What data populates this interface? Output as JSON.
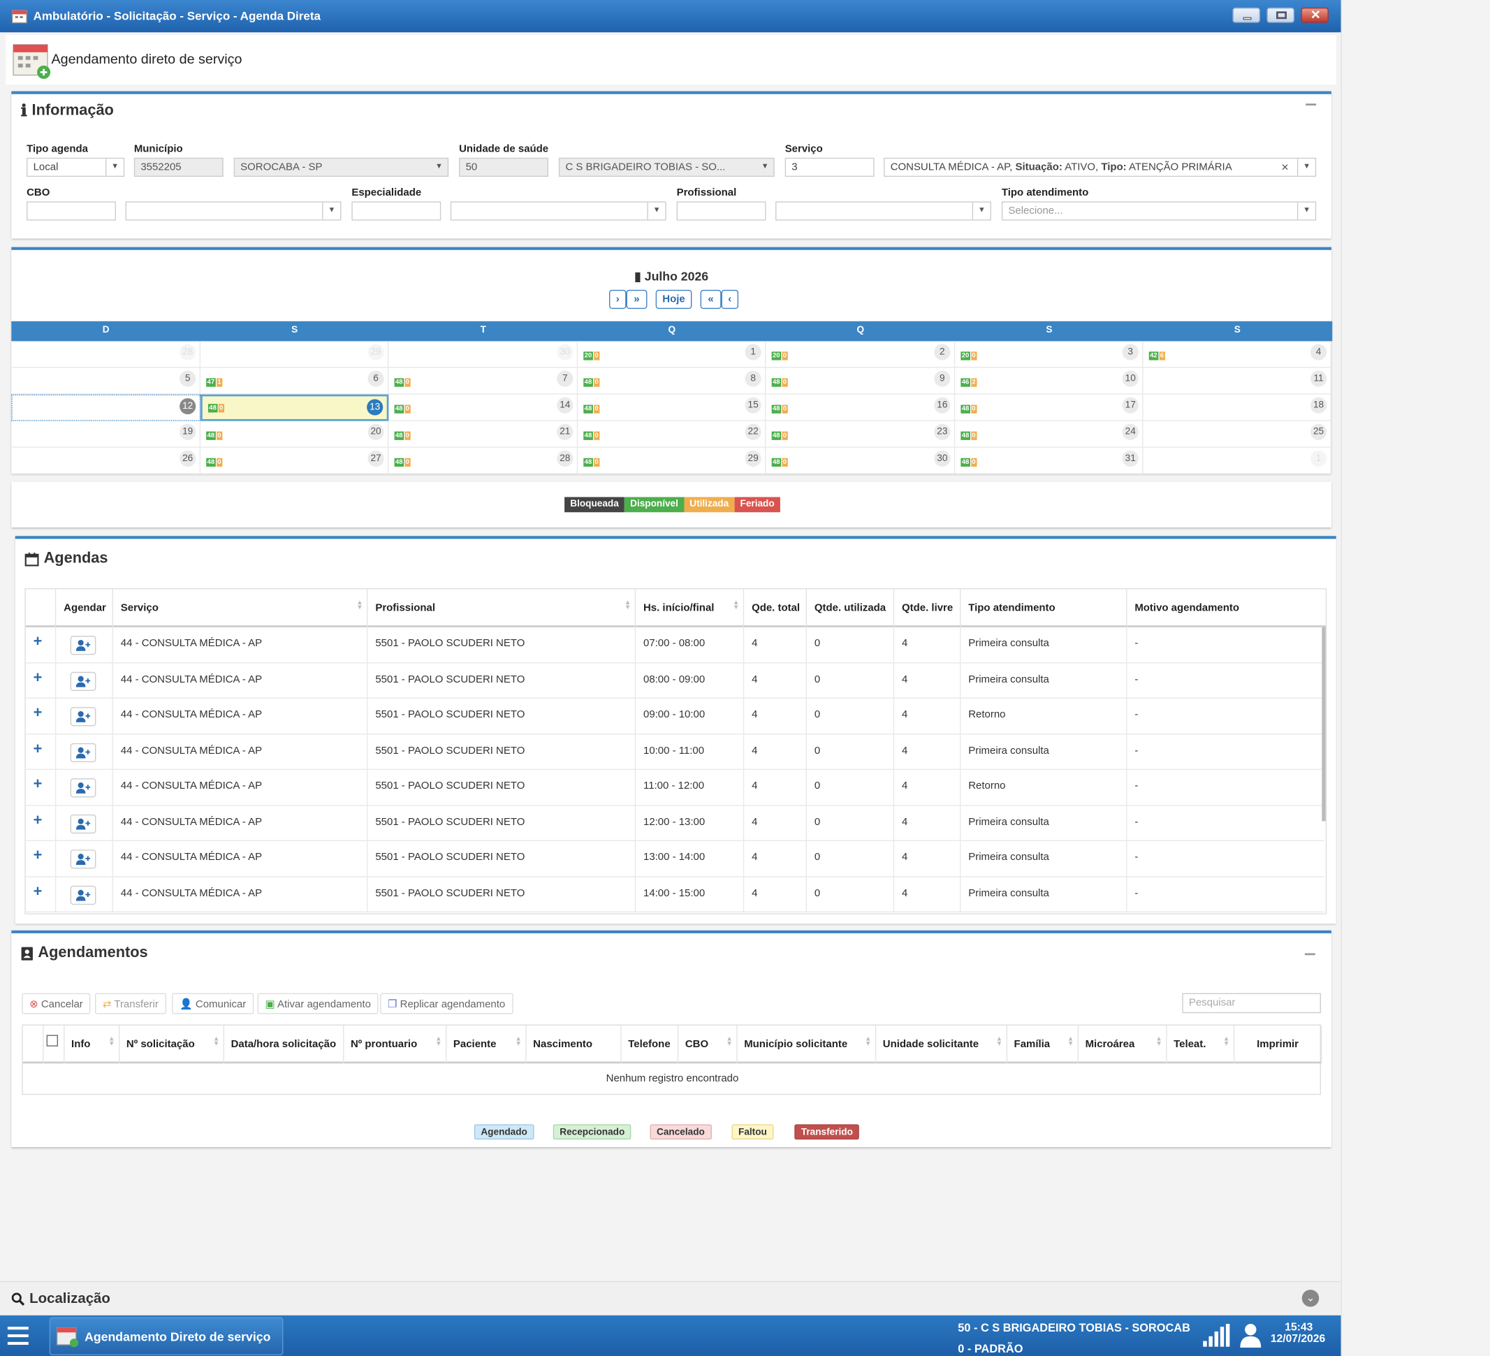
{
  "window": {
    "title": "Ambulatório - Solicitação - Serviço - Agenda Direta"
  },
  "header": {
    "title": "Agendamento direto de serviço"
  },
  "info": {
    "title": "Informação",
    "tipo_agenda_label": "Tipo agenda",
    "tipo_agenda_value": "Local",
    "municipio_label": "Município",
    "municipio_code": "3552205",
    "municipio_name": "SOROCABA - SP",
    "unidade_label": "Unidade de saúde",
    "unidade_code": "50",
    "unidade_name": "C S BRIGADEIRO TOBIAS - SO...",
    "servico_label": "Serviço",
    "servico_code": "3",
    "servico_desc_a": "CONSULTA MÉDICA - AP,",
    "servico_sit_label": "Situação:",
    "servico_sit_value": "ATIVO,",
    "servico_tipo_label": "Tipo:",
    "servico_tipo_value": "ATENÇÃO PRIMÁRIA",
    "cbo_label": "CBO",
    "especialidade_label": "Especialidade",
    "profissional_label": "Profissional",
    "tipo_atend_label": "Tipo atendimento",
    "tipo_atend_placeholder": "Selecione..."
  },
  "calendar": {
    "month_title": "Julho 2026",
    "hoje": "Hoje",
    "nav_next": "›",
    "nav_next2": "»",
    "nav_prev2": "«",
    "nav_prev": "‹",
    "days": [
      "D",
      "S",
      "T",
      "Q",
      "Q",
      "S",
      "S"
    ],
    "weeks": [
      [
        {
          "d": "28",
          "o": true
        },
        {
          "d": "29",
          "o": true
        },
        {
          "d": "30",
          "o": true
        },
        {
          "d": "1",
          "g": "20",
          "u": "0"
        },
        {
          "d": "2",
          "g": "20",
          "u": "0"
        },
        {
          "d": "3",
          "g": "20",
          "u": "0"
        },
        {
          "d": "4",
          "g": "42",
          "u": "6"
        }
      ],
      [
        {
          "d": "5"
        },
        {
          "d": "6",
          "g": "47",
          "u": "1"
        },
        {
          "d": "7",
          "g": "48",
          "u": "0"
        },
        {
          "d": "8",
          "g": "48",
          "u": "0"
        },
        {
          "d": "9",
          "g": "48",
          "u": "0"
        },
        {
          "d": "10",
          "g": "46",
          "u": "2"
        },
        {
          "d": "11"
        }
      ],
      [
        {
          "d": "12",
          "s": "sel"
        },
        {
          "d": "13",
          "s": "today",
          "g": "48",
          "u": "0"
        },
        {
          "d": "14",
          "g": "48",
          "u": "0"
        },
        {
          "d": "15",
          "g": "48",
          "u": "0"
        },
        {
          "d": "16",
          "g": "48",
          "u": "0"
        },
        {
          "d": "17",
          "g": "48",
          "u": "0"
        },
        {
          "d": "18"
        }
      ],
      [
        {
          "d": "19"
        },
        {
          "d": "20",
          "g": "48",
          "u": "0"
        },
        {
          "d": "21",
          "g": "48",
          "u": "0"
        },
        {
          "d": "22",
          "g": "48",
          "u": "0"
        },
        {
          "d": "23",
          "g": "48",
          "u": "0"
        },
        {
          "d": "24",
          "g": "48",
          "u": "0"
        },
        {
          "d": "25"
        }
      ],
      [
        {
          "d": "26"
        },
        {
          "d": "27",
          "g": "48",
          "u": "0"
        },
        {
          "d": "28",
          "g": "48",
          "u": "0"
        },
        {
          "d": "29",
          "g": "48",
          "u": "0"
        },
        {
          "d": "30",
          "g": "48",
          "u": "0"
        },
        {
          "d": "31",
          "g": "48",
          "u": "0"
        },
        {
          "d": "1",
          "o": true
        }
      ]
    ],
    "legend": [
      {
        "label": "Bloqueada",
        "color": "#444444"
      },
      {
        "label": "Disponível",
        "color": "#4cae4c"
      },
      {
        "label": "Utilizada",
        "color": "#f0ad4e"
      },
      {
        "label": "Feriado",
        "color": "#d9534f"
      }
    ]
  },
  "agendas": {
    "title": "Agendas",
    "columns": [
      "Agendar",
      "Serviço",
      "Profissional",
      "Hs. início/final",
      "Qde. total",
      "Qtde. utilizada",
      "Qtde. livre",
      "Tipo atendimento",
      "Motivo agendamento"
    ],
    "rows": [
      [
        "44 - CONSULTA MÉDICA - AP",
        "5501 - PAOLO SCUDERI NETO",
        "07:00 - 08:00",
        "4",
        "0",
        "4",
        "Primeira consulta",
        "-"
      ],
      [
        "44 - CONSULTA MÉDICA - AP",
        "5501 - PAOLO SCUDERI NETO",
        "08:00 - 09:00",
        "4",
        "0",
        "4",
        "Primeira consulta",
        "-"
      ],
      [
        "44 - CONSULTA MÉDICA - AP",
        "5501 - PAOLO SCUDERI NETO",
        "09:00 - 10:00",
        "4",
        "0",
        "4",
        "Retorno",
        "-"
      ],
      [
        "44 - CONSULTA MÉDICA - AP",
        "5501 - PAOLO SCUDERI NETO",
        "10:00 - 11:00",
        "4",
        "0",
        "4",
        "Primeira consulta",
        "-"
      ],
      [
        "44 - CONSULTA MÉDICA - AP",
        "5501 - PAOLO SCUDERI NETO",
        "11:00 - 12:00",
        "4",
        "0",
        "4",
        "Retorno",
        "-"
      ],
      [
        "44 - CONSULTA MÉDICA - AP",
        "5501 - PAOLO SCUDERI NETO",
        "12:00 - 13:00",
        "4",
        "0",
        "4",
        "Primeira consulta",
        "-"
      ],
      [
        "44 - CONSULTA MÉDICA - AP",
        "5501 - PAOLO SCUDERI NETO",
        "13:00 - 14:00",
        "4",
        "0",
        "4",
        "Primeira consulta",
        "-"
      ],
      [
        "44 - CONSULTA MÉDICA - AP",
        "5501 - PAOLO SCUDERI NETO",
        "14:00 - 15:00",
        "4",
        "0",
        "4",
        "Primeira consulta",
        "-"
      ]
    ]
  },
  "agendamentos": {
    "title": "Agendamentos",
    "cancelar": "Cancelar",
    "transferir": "Transferir",
    "comunicar": "Comunicar",
    "ativar": "Ativar agendamento",
    "replicar": "Replicar agendamento",
    "search_placeholder": "Pesquisar",
    "columns": [
      "Info",
      "Nº solicitação",
      "Data/hora solicitação",
      "Nº prontuario",
      "Paciente",
      "Nascimento",
      "Telefone",
      "CBO",
      "Município solicitante",
      "Unidade solicitante",
      "Família",
      "Microárea",
      "Teleat.",
      "Imprimir"
    ],
    "empty": "Nenhum registro encontrado",
    "legend": [
      {
        "label": "Agendado",
        "bg": "#cfe8f7",
        "fg": "#333333",
        "border": "#9cc8e6"
      },
      {
        "label": "Recepcionado",
        "bg": "#d6f0d6",
        "fg": "#333333",
        "border": "#a8d8a8"
      },
      {
        "label": "Cancelado",
        "bg": "#f8dada",
        "fg": "#333333",
        "border": "#e5b0b0"
      },
      {
        "label": "Faltou",
        "bg": "#fff6c8",
        "fg": "#333333",
        "border": "#e7d98c"
      },
      {
        "label": "Transferido",
        "bg": "#c0504d",
        "fg": "#ffffff",
        "border": "#a94442"
      }
    ]
  },
  "localizacao": {
    "title": "Localização"
  },
  "taskbar": {
    "app": "Agendamento Direto de serviço",
    "unit_line1": "50 - C S BRIGADEIRO TOBIAS - SOROCAB",
    "unit_line2": "0 - PADRÃO",
    "time": "15:43",
    "date": "12/07/2026"
  }
}
